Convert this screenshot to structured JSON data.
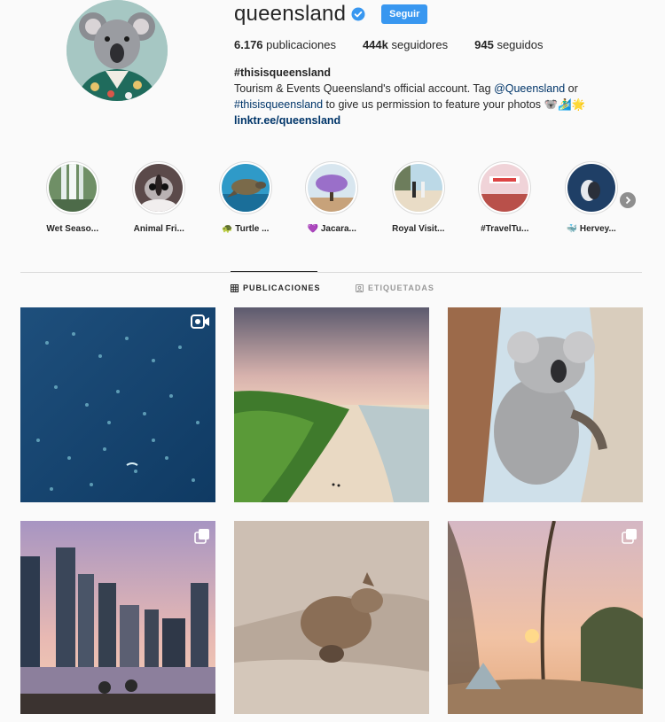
{
  "profile": {
    "username": "queensland",
    "follow_label": "Seguir",
    "stats": {
      "posts_count": "6.176",
      "posts_label": "publicaciones",
      "followers_count": "444k",
      "followers_label": "seguidores",
      "following_count": "945",
      "following_label": "seguidos"
    },
    "bio": {
      "hashtag": "#thisisqueensland",
      "line1_text": "Tourism & Events Queensland's official account. Tag ",
      "line1_mention": "@Queensland",
      "line1_end": " or",
      "line2_hashtag": "#thisisqueensland",
      "line2_text": " to give us permission to feature your photos 🐨🏄‍♂️🌟",
      "link": "linktr.ee/queensland"
    }
  },
  "highlights": [
    {
      "label": "Wet Seaso...",
      "icon": "waterfall"
    },
    {
      "label": "Animal Fri...",
      "icon": "sugar-glider"
    },
    {
      "label": "🐢 Turtle ...",
      "icon": "turtle"
    },
    {
      "label": "💜 Jacara...",
      "icon": "jacaranda-tree"
    },
    {
      "label": "Royal Visit...",
      "icon": "beach-people"
    },
    {
      "label": "#TravelTu...",
      "icon": "boat-rocks"
    },
    {
      "label": "🐳 Hervey...",
      "icon": "whale"
    }
  ],
  "tabs": {
    "posts": "PUBLICACIONES",
    "tagged": "ETIQUETADAS"
  },
  "posts": [
    {
      "subject": "ocean-rays-aerial",
      "badge": "video-icon"
    },
    {
      "subject": "beach-palms-sunset",
      "badge": ""
    },
    {
      "subject": "koala-tree",
      "badge": ""
    },
    {
      "subject": "city-skyline-dusk",
      "badge": "carousel-icon"
    },
    {
      "subject": "rock-wallaby-joey",
      "badge": ""
    },
    {
      "subject": "campsite-sunset",
      "badge": "carousel-icon"
    }
  ],
  "colors": {
    "accent_blue": "#3897f0",
    "link_blue": "#003569",
    "text": "#262626",
    "muted": "#999999",
    "background": "#fafafa"
  }
}
